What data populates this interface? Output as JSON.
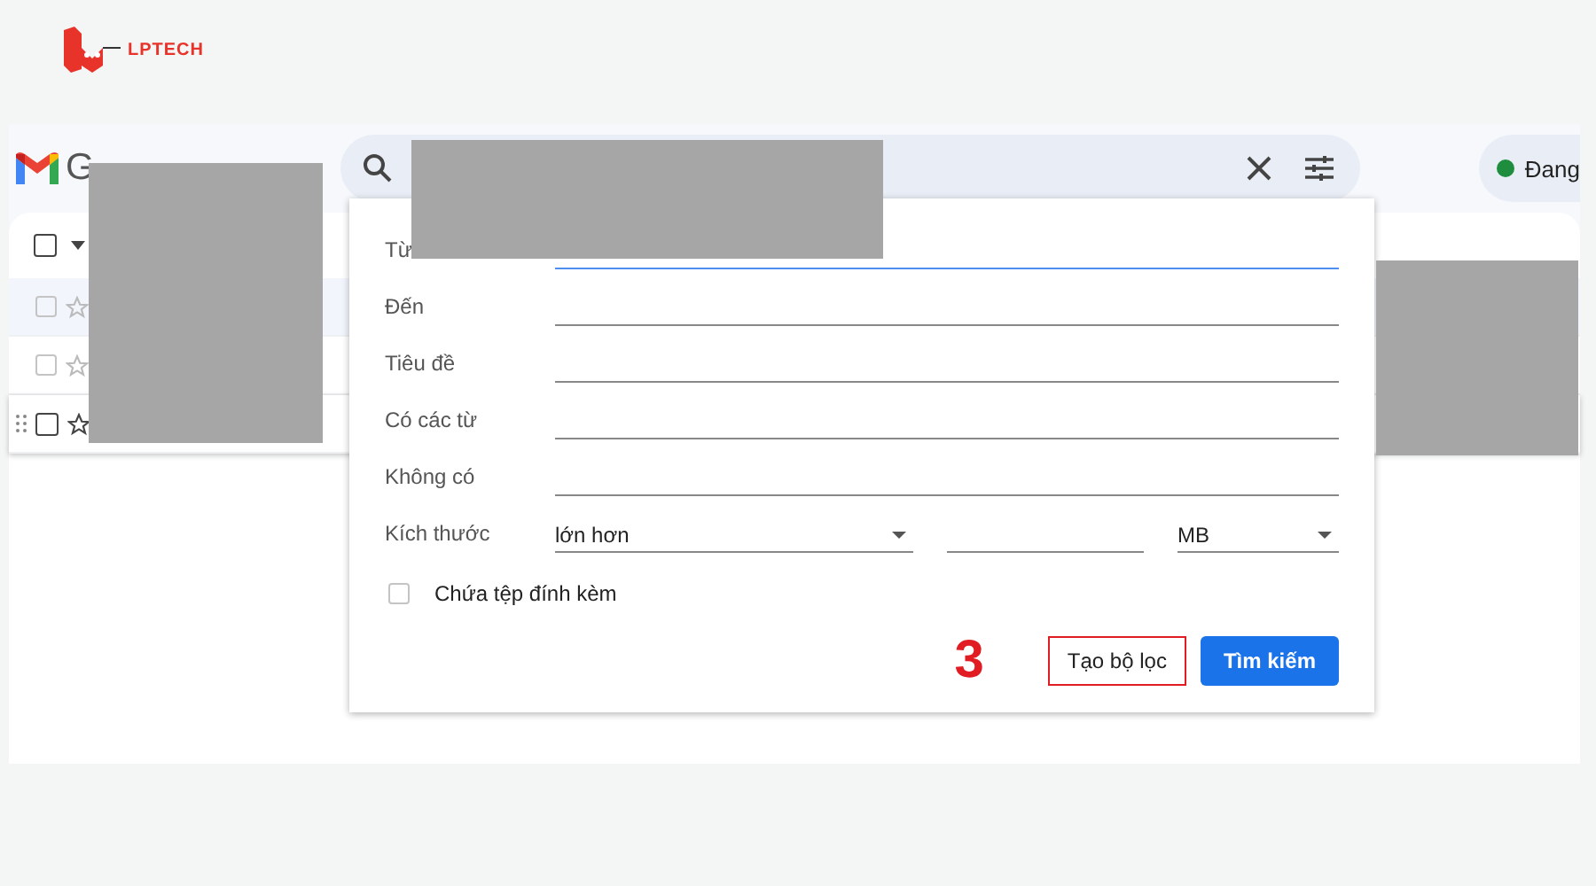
{
  "logo": {
    "text": "LPTECH"
  },
  "app": {
    "name": "G"
  },
  "status": {
    "label": "Đang",
    "color": "#1e8e3e"
  },
  "select_all": {
    "checked": false
  },
  "mail_rows": [
    {
      "read": true,
      "hovered": false,
      "checked": false
    },
    {
      "read": false,
      "hovered": false,
      "checked": false
    },
    {
      "read": false,
      "hovered": true,
      "checked": false
    }
  ],
  "search_form": {
    "fields": [
      {
        "label": "Từ",
        "focused": true
      },
      {
        "label": "Đến",
        "focused": false
      },
      {
        "label": "Tiêu đề",
        "focused": false
      },
      {
        "label": "Có các từ",
        "focused": false
      },
      {
        "label": "Không có",
        "focused": false
      }
    ],
    "size": {
      "label": "Kích thước",
      "comparison": "lớn hơn",
      "unit": "MB"
    },
    "attachment": {
      "label": "Chứa tệp đính kèm",
      "checked": false
    },
    "step_marker": "3",
    "buttons": [
      {
        "label": "Tạo bộ lọc",
        "kind": "outlined",
        "highlighted": true
      },
      {
        "label": "Tìm kiếm",
        "kind": "primary",
        "highlighted": false
      }
    ]
  }
}
